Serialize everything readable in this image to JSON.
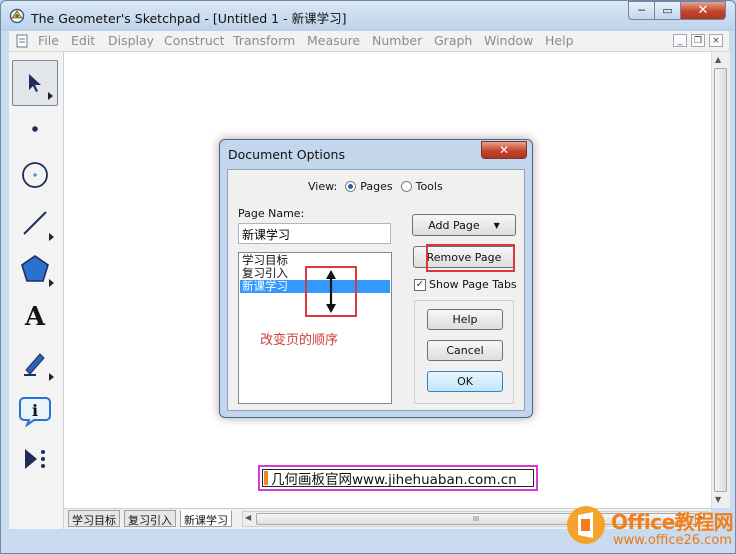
{
  "window": {
    "title": "The Geometer's Sketchpad - [Untitled 1 - 新课学习]",
    "controls": {
      "minimize": "─",
      "maximize": "▭",
      "close": "✕"
    }
  },
  "menubar": {
    "items": [
      "File",
      "Edit",
      "Display",
      "Construct",
      "Transform",
      "Measure",
      "Number",
      "Graph",
      "Window",
      "Help"
    ],
    "mdi": {
      "minimize": "_",
      "restore": "❐",
      "close": "×"
    }
  },
  "toolbox": {
    "tools": [
      "arrow-select-tool",
      "point-tool",
      "compass-tool",
      "straightedge-tool",
      "polygon-tool",
      "text-tool",
      "marker-tool",
      "information-tool",
      "custom-tools"
    ],
    "text_tool_glyph": "A",
    "info_tool_glyph": "i"
  },
  "page_tabs": [
    "学习目标",
    "复习引入",
    "新课学习"
  ],
  "active_tab": "新课学习",
  "hscroll_grip": "III",
  "url_banner": "几何画板官网www.jihehuaban.com.cn",
  "dialog": {
    "title": "Document Options",
    "close_glyph": "✕",
    "view_label": "View:",
    "view_options": [
      {
        "label": "Pages",
        "selected": true
      },
      {
        "label": "Tools",
        "selected": false
      }
    ],
    "page_name_label": "Page Name:",
    "page_name_value": "新课学习",
    "pages": [
      "学习目标",
      "复习引入",
      "新课学习"
    ],
    "selected_page": "新课学习",
    "annotation": "改变页的顺序",
    "add_page": "Add Page",
    "remove_page": "Remove Page",
    "show_page_tabs": {
      "label": "Show Page Tabs",
      "checked": true,
      "mark": "✓"
    },
    "help": "Help",
    "cancel": "Cancel",
    "ok": "OK"
  },
  "watermark": {
    "brand": "Office教程网",
    "url": "www.office26.com"
  },
  "colors": {
    "accent_red": "#d8393a",
    "banner_border": "#d63bd5",
    "selection": "#3399ff",
    "watermark_orange": "#f07f1c"
  }
}
